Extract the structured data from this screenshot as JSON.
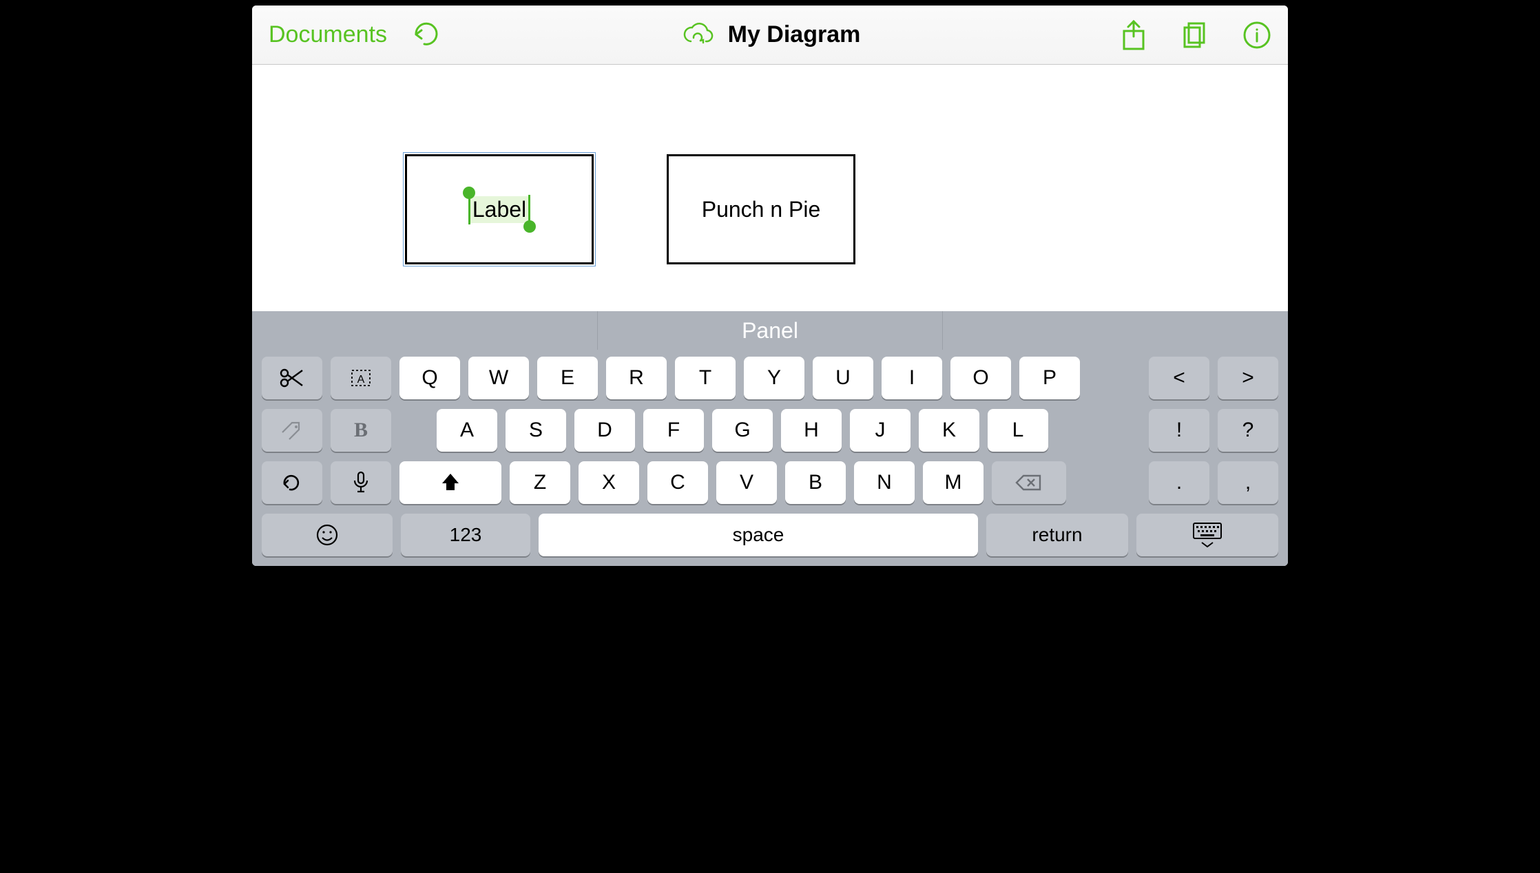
{
  "colors": {
    "accent": "#58c322"
  },
  "toolbar": {
    "documents_label": "Documents",
    "title": "My Diagram"
  },
  "canvas": {
    "shapes": [
      {
        "text": "Label",
        "selected": true,
        "editing": true
      },
      {
        "text": "Punch n Pie",
        "selected": false,
        "editing": false
      }
    ]
  },
  "keyboard": {
    "suggestions": [
      "",
      "Panel",
      ""
    ],
    "rows": {
      "r1": [
        "Q",
        "W",
        "E",
        "R",
        "T",
        "Y",
        "U",
        "I",
        "O",
        "P"
      ],
      "r1_extra": [
        "<",
        ">"
      ],
      "r2": [
        "A",
        "S",
        "D",
        "F",
        "G",
        "H",
        "J",
        "K",
        "L"
      ],
      "r2_extra": [
        "!",
        "?"
      ],
      "r3": [
        "Z",
        "X",
        "C",
        "V",
        "B",
        "N",
        "M"
      ],
      "r3_extra": [
        ".",
        ","
      ]
    },
    "numbers_label": "123",
    "space_label": "space",
    "return_label": "return",
    "bold_label": "B"
  }
}
